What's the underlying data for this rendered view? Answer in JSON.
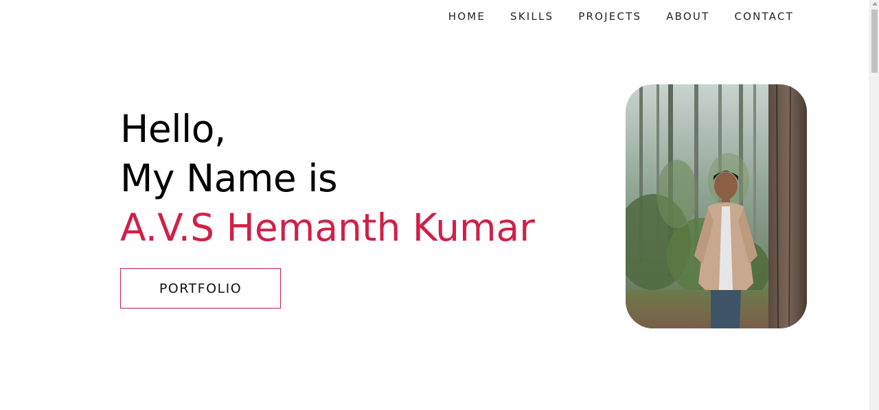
{
  "nav": {
    "items": [
      {
        "label": "HOME"
      },
      {
        "label": "SKILLS"
      },
      {
        "label": "PROJECTS"
      },
      {
        "label": "ABOUT"
      },
      {
        "label": "CONTACT"
      }
    ]
  },
  "hero": {
    "greeting": "Hello,",
    "intro": "My Name is",
    "name": "A.V.S Hemanth Kumar",
    "button_label": "PORTFOLIO"
  },
  "colors": {
    "accent": "#d21f47",
    "text": "#000000",
    "nav_text": "#222222"
  }
}
